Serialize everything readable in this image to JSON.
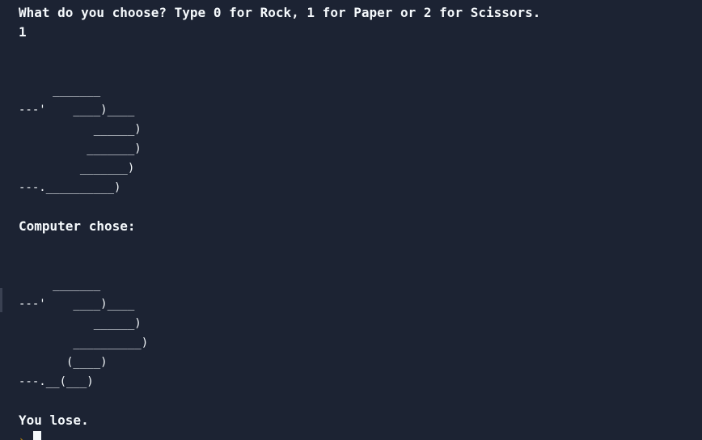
{
  "console": {
    "prompt_question": "What do you choose? Type 0 for Rock, 1 for Paper or 2 for Scissors.",
    "user_input": "1",
    "player_art": [
      "",
      "",
      "     _______",
      "---'    ____)____",
      "           ______)",
      "          _______)",
      "         _______)",
      "---.__________)"
    ],
    "computer_label": "Computer chose:",
    "computer_art": [
      "",
      "",
      "     _______",
      "---'    ____)____",
      "           ______)",
      "        __________)",
      "       (____)",
      "---.__(___)"
    ],
    "result_text": "You lose.",
    "prompt_symbol": "›"
  },
  "colors": {
    "background": "#1c2333",
    "text": "#f5f9fc",
    "prompt_accent": "#b5830e"
  }
}
